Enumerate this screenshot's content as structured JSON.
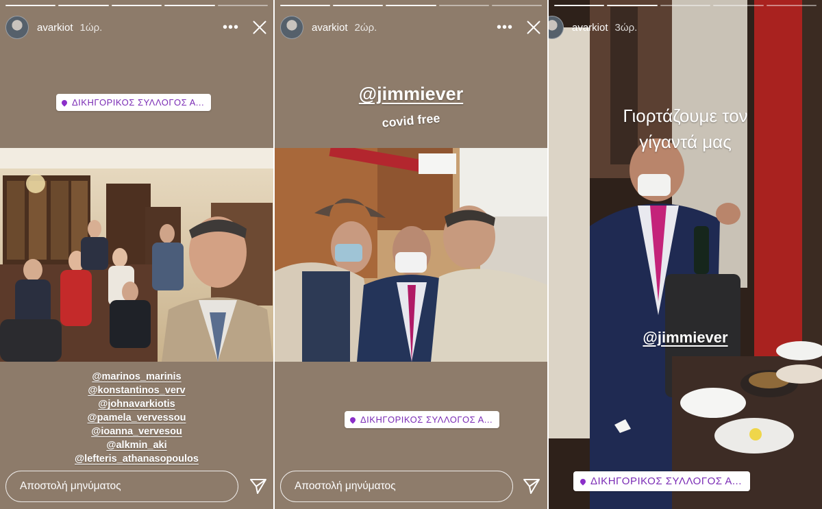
{
  "stories": [
    {
      "username": "avarkiot",
      "time": "1ώρ.",
      "location": "ΔΙΚΗΓΟΡΙΚΟΣ ΣΥΛΛΟΓΟΣ Α...",
      "mentions": [
        "@marinos_marinis",
        "@konstantinos_verv",
        "@johnavarkiotis",
        "@pamela_vervessou",
        "@ioanna_vervesou",
        "@alkmin_aki",
        "@lefteris_athanasopoulos"
      ],
      "reply_placeholder": "Αποστολή μηνύματος"
    },
    {
      "username": "avarkiot",
      "time": "2ώρ.",
      "mention_big": "@jimmiever",
      "caption": "covid free",
      "location": "ΔΙΚΗΓΟΡΙΚΟΣ ΣΥΛΛΟΓΟΣ Α...",
      "reply_placeholder": "Αποστολή μηνύματος"
    },
    {
      "username": "avarkiot",
      "time": "3ώρ.",
      "caption_line1": "Γιορτάζουμε τον",
      "caption_line2": "γίγαντά μας",
      "mention_big": "@jimmiever",
      "location": "ΔΙΚΗΓΟΡΙΚΟΣ ΣΥΛΛΟΓΟΣ Α..."
    }
  ],
  "colors": {
    "location_text": "#7a2bb5",
    "panel_bg": "#8d7b6a"
  }
}
